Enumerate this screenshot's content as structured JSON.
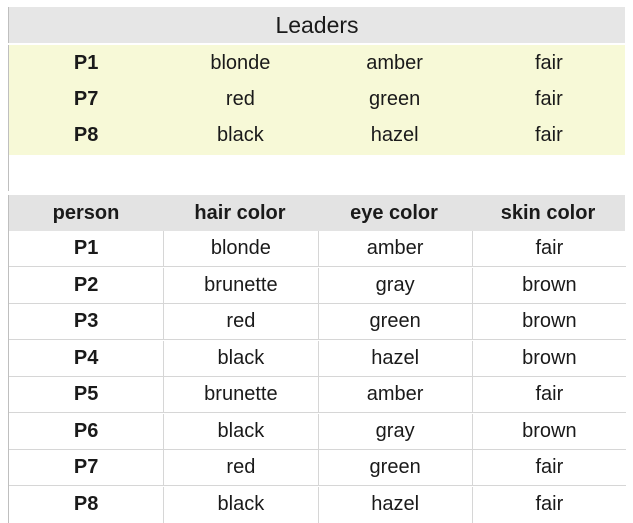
{
  "leaders": {
    "title": "Leaders",
    "rows": [
      {
        "person": "P1",
        "hair": "blonde",
        "eye": "amber",
        "skin": "fair"
      },
      {
        "person": "P7",
        "hair": "red",
        "eye": "green",
        "skin": "fair"
      },
      {
        "person": "P8",
        "hair": "black",
        "eye": "hazel",
        "skin": "fair"
      }
    ]
  },
  "table": {
    "headers": [
      "person",
      "hair color",
      "eye color",
      "skin color"
    ],
    "rows": [
      {
        "person": "P1",
        "hair": "blonde",
        "eye": "amber",
        "skin": "fair"
      },
      {
        "person": "P2",
        "hair": "brunette",
        "eye": "gray",
        "skin": "brown"
      },
      {
        "person": "P3",
        "hair": "red",
        "eye": "green",
        "skin": "brown"
      },
      {
        "person": "P4",
        "hair": "black",
        "eye": "hazel",
        "skin": "brown"
      },
      {
        "person": "P5",
        "hair": "brunette",
        "eye": "amber",
        "skin": "fair"
      },
      {
        "person": "P6",
        "hair": "black",
        "eye": "gray",
        "skin": "brown"
      },
      {
        "person": "P7",
        "hair": "red",
        "eye": "green",
        "skin": "fair"
      },
      {
        "person": "P8",
        "hair": "black",
        "eye": "hazel",
        "skin": "fair"
      }
    ]
  },
  "colors": {
    "leaders_title_bg": "#e6e6e6",
    "leaders_body_bg": "#f7f9d7",
    "header_bg": "#e3e3e3"
  }
}
